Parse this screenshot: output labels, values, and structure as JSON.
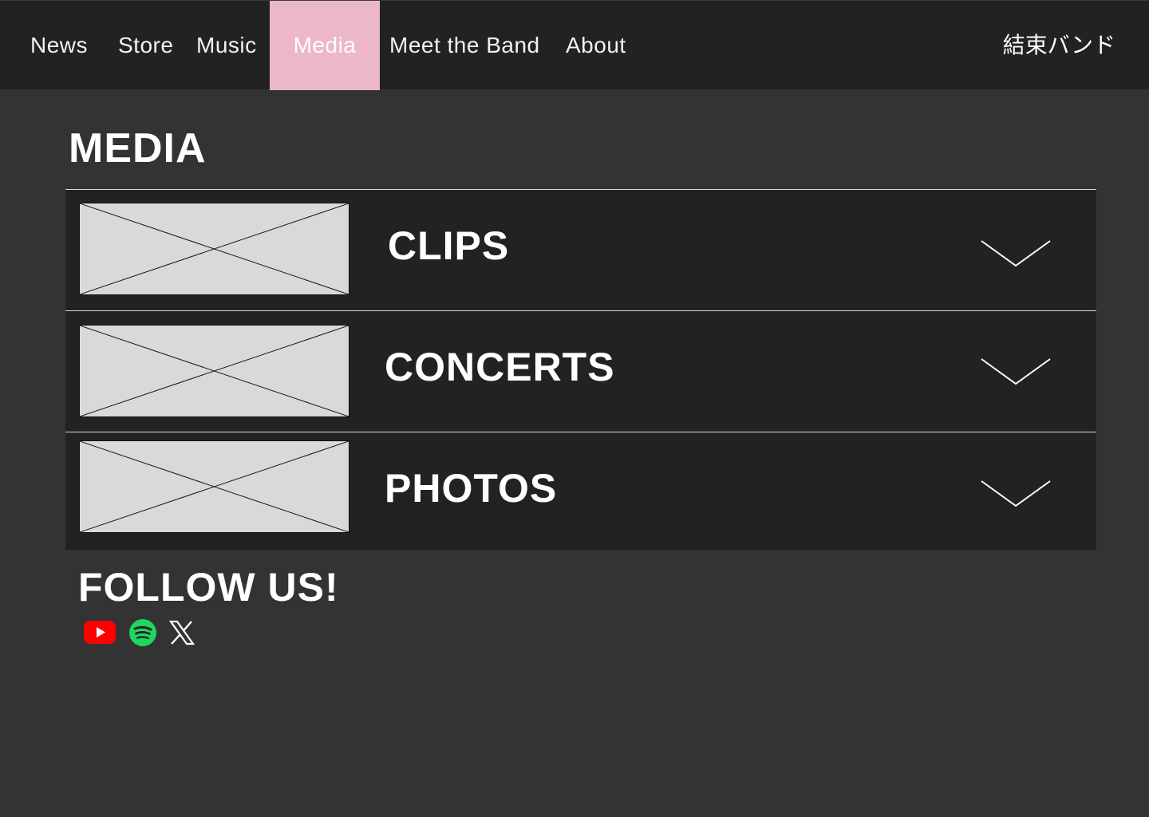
{
  "nav": {
    "items": [
      {
        "label": "News"
      },
      {
        "label": "Store"
      },
      {
        "label": "Music"
      },
      {
        "label": "Media",
        "active": true
      },
      {
        "label": "Meet the Band"
      },
      {
        "label": "About"
      }
    ],
    "brand": "結束バンド",
    "active_color": "#ecb7c6"
  },
  "main": {
    "title": "MEDIA",
    "sections": [
      {
        "label": "CLIPS",
        "icon": "chevron-down-icon"
      },
      {
        "label": "CONCERTS",
        "icon": "chevron-down-icon"
      },
      {
        "label": "PHOTOS",
        "icon": "chevron-down-icon"
      }
    ]
  },
  "follow": {
    "title": "FOLLOW US!",
    "links": [
      {
        "name": "youtube-icon",
        "color": "#ff0000"
      },
      {
        "name": "spotify-icon",
        "color": "#1ed760"
      },
      {
        "name": "x-icon",
        "color": "#ffffff"
      }
    ]
  }
}
